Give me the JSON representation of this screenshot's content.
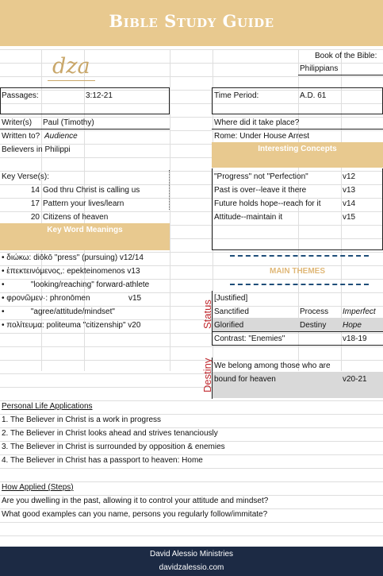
{
  "header": {
    "title": "Bible Study Guide"
  },
  "logo": {
    "text": "dza"
  },
  "book": {
    "label": "Book of the Bible:",
    "value": "Philippians"
  },
  "passages": {
    "label": "Passages:",
    "value": "3:12-21"
  },
  "time_period": {
    "label": "Time Period:",
    "value": "A.D. 61"
  },
  "writer": {
    "label": "Writer(s)",
    "value": "Paul (Timothy)"
  },
  "written_to": {
    "label": "Written to?",
    "value": "Audience",
    "value2": "Believers in Philippi"
  },
  "where": {
    "label": "Where did it take place?",
    "value": "Rome: Under House Arrest"
  },
  "interesting": {
    "title": "Interesting Concepts",
    "rows": [
      {
        "text": "\"Progress\" not \"Perfection\"",
        "ref": "v12"
      },
      {
        "text": "Past is over--leave it there",
        "ref": "v13"
      },
      {
        "text": "Future holds hope--reach for it",
        "ref": "v14"
      },
      {
        "text": "Attitude--maintain it",
        "ref": "v15"
      }
    ]
  },
  "key_verses": {
    "label": "Key Verse(s):",
    "rows": [
      {
        "num": "14",
        "text": "God thru Christ is calling us"
      },
      {
        "num": "17",
        "text": "Pattern your lives/learn"
      },
      {
        "num": "20",
        "text": "Citizens of heaven"
      }
    ]
  },
  "keywords": {
    "title": "Key Word Meanings",
    "rows": [
      {
        "text": "• διώκω: diōkō \"press\" (pursuing) v12/14",
        "ref": ""
      },
      {
        "text": "• ἐπεκτεινόμενος,: epekteinomenos v13",
        "ref": ""
      },
      {
        "text": "•            \"looking/reaching\" forward-athlete",
        "ref": ""
      },
      {
        "text": "• φρονῶμεν·: phronōmen",
        "ref": "v15"
      },
      {
        "text": "•            \"agree/attitude/mindset\"",
        "ref": ""
      },
      {
        "text": "• πολίτευμα: politeuma \"citizenship\" v20",
        "ref": ""
      }
    ]
  },
  "main_themes": {
    "title": "MAIN THEMES",
    "status_label": "Status",
    "justified": "[Justified]",
    "sanctified": {
      "a": "Sanctified",
      "b": "Process",
      "c": "Imperfect"
    },
    "glorified": {
      "a": "Glorified",
      "b": "Destiny",
      "c": "Hope"
    },
    "contrast": {
      "a": "Contrast: \"Enemies\"",
      "ref": "v18-19"
    },
    "destiny_label": "Destiny",
    "belong1": "We belong among those who are",
    "belong2": "bound for heaven",
    "belong_ref": "v20-21"
  },
  "applications": {
    "title": "Personal Life Applications",
    "items": [
      "1. The Believer in Christ is a work in progress",
      "2. The Believer in Christ looks ahead and strives tenanciously",
      "3. The Believer in Christ is surrounded by opposition & enemies",
      "4. The Believer in Christ has a passport to heaven: Home"
    ]
  },
  "how_applied": {
    "title": "How Applied (Steps)",
    "items": [
      "Are you dwelling in the past, allowing it to control your attitude and mindset?",
      "What good examples can you name, persons you regularly follow/immitate?"
    ]
  },
  "footer": {
    "name": "David Alessio Ministries",
    "url": "davidzalessio.com"
  },
  "colors": {
    "tan": "#e8c98f",
    "navy": "#1c2a44",
    "red": "#c0272d",
    "gray": "#d9d9d9"
  }
}
